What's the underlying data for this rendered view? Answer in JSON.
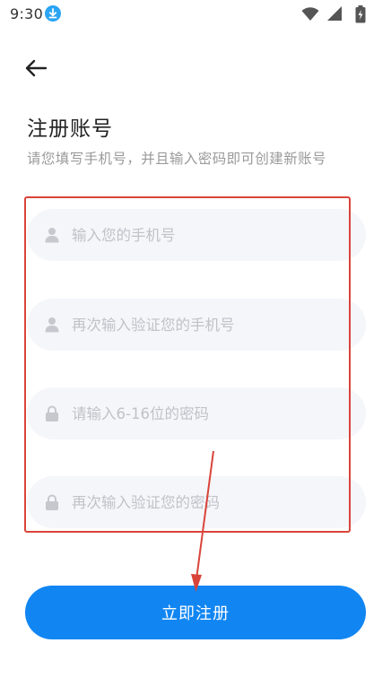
{
  "status_bar": {
    "time": "9:30"
  },
  "header": {
    "title": "注册账号",
    "subtitle": "请您填写手机号，并且输入密码即可创建新账号"
  },
  "form": {
    "phone_placeholder": "输入您的手机号",
    "phone_confirm_placeholder": "再次输入验证您的手机号",
    "password_placeholder": "请输入6-16位的密码",
    "password_confirm_placeholder": "再次输入验证您的密码"
  },
  "actions": {
    "submit_label": "立即注册"
  },
  "colors": {
    "accent": "#1186f2",
    "annotation": "#d9443a"
  }
}
